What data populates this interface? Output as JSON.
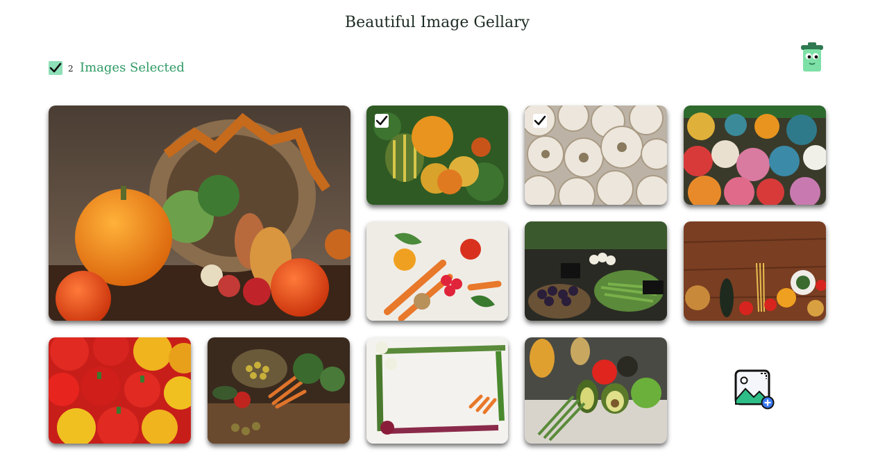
{
  "header": {
    "title": "Beautiful Image Gellary"
  },
  "selection": {
    "count": "2",
    "label": "Images Selected",
    "checked": true
  },
  "toolbar": {
    "delete_icon": "trash-can-icon",
    "add_icon": "add-image-icon"
  },
  "gallery": {
    "images": [
      {
        "subject": "pumpkins-basket",
        "selected": false,
        "featured": true
      },
      {
        "subject": "squash-pumpkins",
        "selected": true
      },
      {
        "subject": "garlic",
        "selected": true
      },
      {
        "subject": "colorful-pumpkins",
        "selected": false
      },
      {
        "subject": "carrots-vegetables",
        "selected": false
      },
      {
        "subject": "market-vegetables",
        "selected": false
      },
      {
        "subject": "pasta-vegetables-table",
        "selected": false
      },
      {
        "subject": "red-yellow-peppers",
        "selected": false
      },
      {
        "subject": "vegetable-harvest",
        "selected": false
      },
      {
        "subject": "vegetable-frame",
        "selected": false
      },
      {
        "subject": "avocado-tomato-asparagus",
        "selected": false
      }
    ]
  },
  "colors": {
    "accent": "#2e9a63",
    "checkbox": "#8fe0b8",
    "trash": "#7de0a6"
  }
}
